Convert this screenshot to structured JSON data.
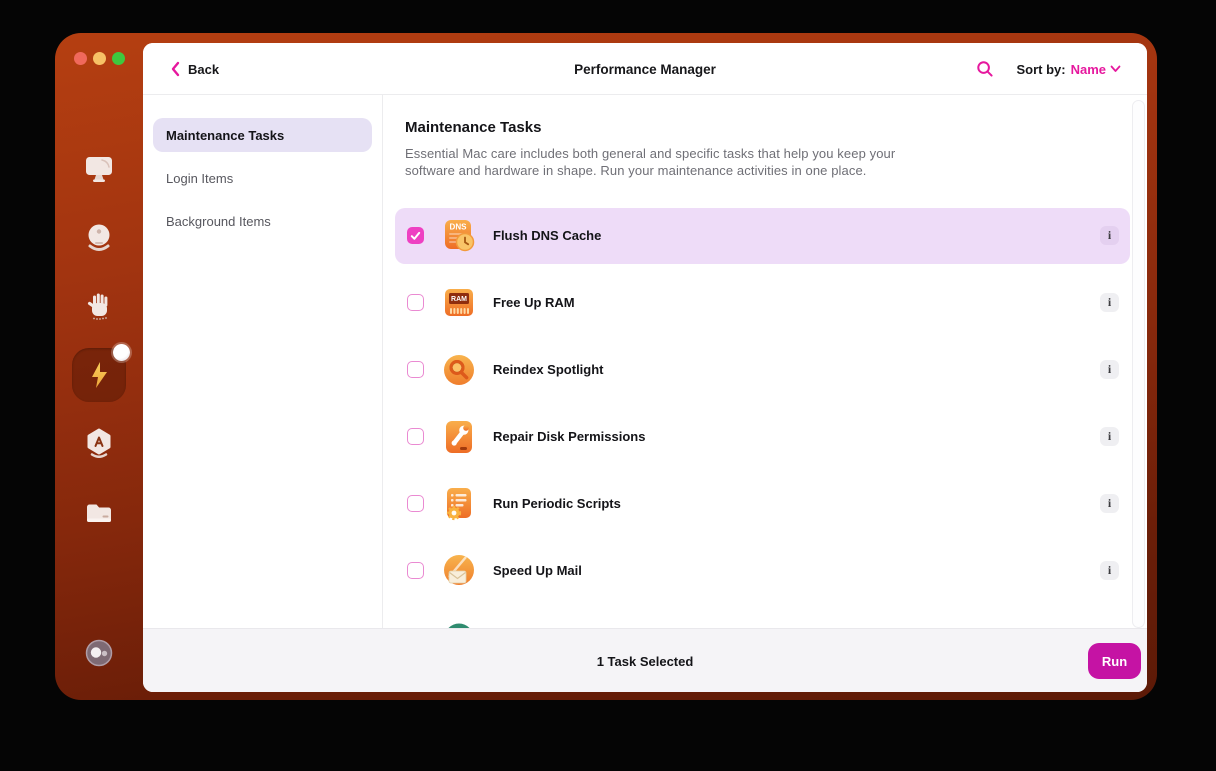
{
  "app": {
    "traffic_lights": [
      "close",
      "minimize",
      "zoom"
    ],
    "sidebar_icons": [
      {
        "name": "mac-display"
      },
      {
        "name": "protection-orb"
      },
      {
        "name": "privacy-hand"
      },
      {
        "name": "performance-lightning",
        "active": true,
        "badge": true
      },
      {
        "name": "applications"
      },
      {
        "name": "files-folder"
      },
      {
        "name": "assistant"
      }
    ]
  },
  "header": {
    "back_label": "Back",
    "title": "Performance Manager",
    "sort_by_label": "Sort by:",
    "sort_value": "Name"
  },
  "nav": {
    "items": [
      {
        "label": "Maintenance Tasks",
        "selected": true
      },
      {
        "label": "Login Items",
        "selected": false
      },
      {
        "label": "Background Items",
        "selected": false
      }
    ]
  },
  "content": {
    "heading": "Maintenance Tasks",
    "description": "Essential Mac care includes both general and specific tasks that help you keep your software and hardware in shape. Run your maintenance activities in one place.",
    "info_glyph": "i",
    "tasks": [
      {
        "label": "Flush DNS Cache",
        "checked": true,
        "icon": "dns-clock-icon",
        "icon_text": "DNS"
      },
      {
        "label": "Free Up RAM",
        "checked": false,
        "icon": "ram-chip-icon",
        "icon_text": "RAM"
      },
      {
        "label": "Reindex Spotlight",
        "checked": false,
        "icon": "spotlight-magnifier-icon"
      },
      {
        "label": "Repair Disk Permissions",
        "checked": false,
        "icon": "disk-wrench-icon"
      },
      {
        "label": "Run Periodic Scripts",
        "checked": false,
        "icon": "scripts-gear-icon"
      },
      {
        "label": "Speed Up Mail",
        "checked": false,
        "icon": "mail-stamp-icon"
      }
    ]
  },
  "footer": {
    "status": "1 Task Selected",
    "run_label": "Run"
  },
  "colors": {
    "accent_pink": "#e6189e",
    "run_button": "#c513a4",
    "selected_row_bg": "#eedcf8",
    "nav_selected_bg": "#e6e1f4",
    "checkbox_checked": "#ee40c2",
    "window_top": "#b53f11",
    "window_bottom": "#5c1a07"
  }
}
